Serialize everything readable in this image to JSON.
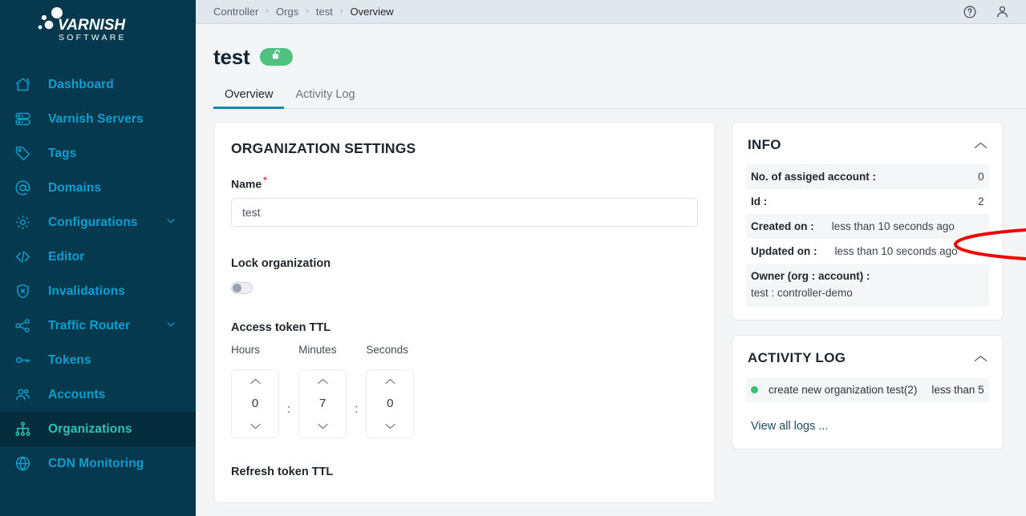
{
  "brand": {
    "name": "VARNISH",
    "subname": "SOFTWARE",
    "sidebar_bg": "#06394d",
    "accent": "#0e9fd0",
    "active_text": "#2ec4b6",
    "tab_accent": "#0d8aa8",
    "annotation_color": "#ee0000"
  },
  "sidebar": {
    "items": [
      {
        "label": "Dashboard",
        "icon": "home-icon",
        "active": false,
        "expandable": false
      },
      {
        "label": "Varnish Servers",
        "icon": "server-icon",
        "active": false,
        "expandable": false
      },
      {
        "label": "Tags",
        "icon": "tag-icon",
        "active": false,
        "expandable": false
      },
      {
        "label": "Domains",
        "icon": "at-sign-icon",
        "active": false,
        "expandable": false
      },
      {
        "label": "Configurations",
        "icon": "gear-icon",
        "active": false,
        "expandable": true
      },
      {
        "label": "Editor",
        "icon": "code-icon",
        "active": false,
        "expandable": false
      },
      {
        "label": "Invalidations",
        "icon": "shield-x-icon",
        "active": false,
        "expandable": false
      },
      {
        "label": "Traffic Router",
        "icon": "share-nodes-icon",
        "active": false,
        "expandable": true
      },
      {
        "label": "Tokens",
        "icon": "key-icon",
        "active": false,
        "expandable": false
      },
      {
        "label": "Accounts",
        "icon": "users-icon",
        "active": false,
        "expandable": false
      },
      {
        "label": "Organizations",
        "icon": "org-tree-icon",
        "active": true,
        "expandable": false
      },
      {
        "label": "CDN Monitoring",
        "icon": "globe-icon",
        "active": false,
        "expandable": false
      }
    ]
  },
  "topbar": {
    "breadcrumbs": [
      "Controller",
      "Orgs",
      "test",
      "Overview"
    ],
    "separator": "›",
    "help_icon": "help-circle-icon",
    "user_icon": "user-icon"
  },
  "header": {
    "title": "test",
    "badge_icon": "unlock-icon",
    "badge_color": "#4fc281"
  },
  "tabs": [
    {
      "label": "Overview",
      "active": true
    },
    {
      "label": "Activity Log",
      "active": false
    }
  ],
  "org_settings": {
    "heading": "ORGANIZATION SETTINGS",
    "name_label": "Name",
    "name_required_mark": "*",
    "name_value": "test",
    "name_placeholder": "test",
    "lock_label": "Lock organization",
    "lock_enabled": false,
    "access_ttl_label": "Access token TTL",
    "ttl_separator": ":",
    "ttl_units": [
      {
        "caption": "Hours",
        "value": "0"
      },
      {
        "caption": "Minutes",
        "value": "7"
      },
      {
        "caption": "Seconds",
        "value": "0"
      }
    ],
    "refresh_ttl_label": "Refresh token TTL"
  },
  "info_panel": {
    "title": "INFO",
    "collapse_icon": "chevron-up-icon",
    "rows": [
      {
        "key": "No. of assiged account :",
        "value": "0",
        "stacked": false,
        "value_left": false
      },
      {
        "key": "Id :",
        "value": "2",
        "stacked": false,
        "value_left": false
      },
      {
        "key": "Created on :",
        "value": "less than 10 seconds ago",
        "stacked": false,
        "value_left": true
      },
      {
        "key": "Updated on :",
        "value": "less than 10 seconds ago",
        "stacked": false,
        "value_left": true
      },
      {
        "key": "Owner (org : account) :",
        "value": "test : controller-demo",
        "stacked": true,
        "value_left": false
      }
    ]
  },
  "activity_panel": {
    "title": "ACTIVITY LOG",
    "collapse_icon": "chevron-up-icon",
    "entries": [
      {
        "status_color": "#33c272",
        "text": "create new organization test(2)",
        "time": "less than 5"
      }
    ],
    "view_all_label": "View all logs ..."
  },
  "annotation": {
    "type": "ellipse",
    "target": "Id :",
    "color": "#ee0000"
  }
}
